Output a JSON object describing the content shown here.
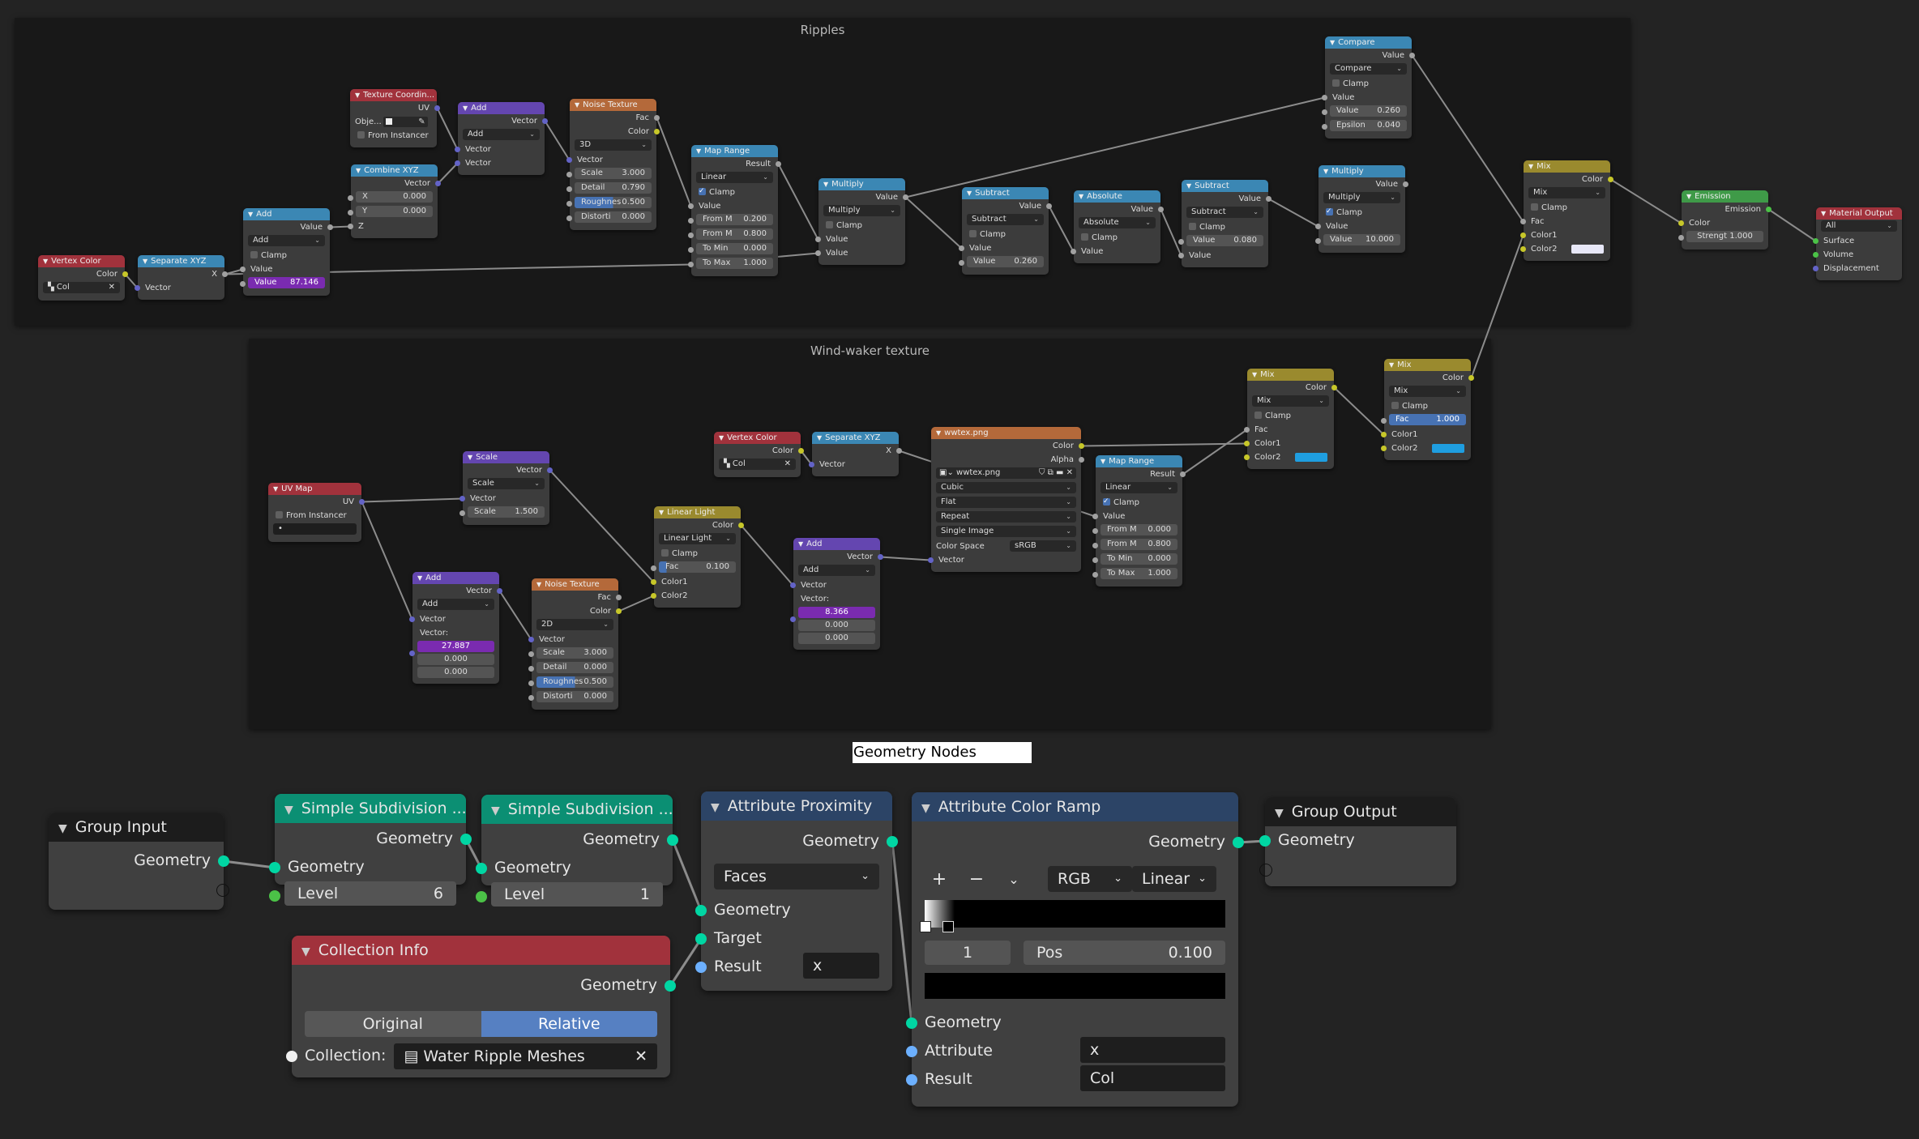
{
  "frames": {
    "ripples": {
      "title": "Ripples"
    },
    "windwaker": {
      "title": "Wind-waker texture"
    },
    "geometry_nodes_label": "Geometry Nodes"
  },
  "colors": {
    "header_input": "#a1323c",
    "header_converter": "#3b87b4",
    "header_vector": "#6446b0",
    "header_texture": "#b4693a",
    "header_color": "#9a8a2e",
    "header_shader": "#3f9a48",
    "header_output": "#a1323c",
    "header_geometry": "#0b8f73",
    "header_attribute": "#2c4466",
    "header_group": "#1c1c1c",
    "mix_color_white": "#e8e8f8",
    "mix_color_blue": "#1f9ee0"
  },
  "ripples": {
    "vertex_color": {
      "title": "Vertex Color",
      "out_color": "Color",
      "layer": "Col"
    },
    "separate_xyz": {
      "title": "Separate XYZ",
      "out_x": "X",
      "in_vector": "Vector"
    },
    "add_math": {
      "title": "Add",
      "out": "Value",
      "op": "Add",
      "clamp": "Clamp",
      "clamp_on": false,
      "in_value": "Value",
      "value_label": "Value",
      "value": "87.146"
    },
    "tex_coord": {
      "title": "Texture Coordin...",
      "out_uv": "UV",
      "object_label": "Obje...",
      "from_instancer": "From Instancer"
    },
    "combine_xyz": {
      "title": "Combine XYZ",
      "out": "Vector",
      "x_label": "X",
      "x": "0.000",
      "y_label": "Y",
      "y": "0.000",
      "z_label": "Z"
    },
    "vector_add": {
      "title": "Add",
      "out": "Vector",
      "op": "Add",
      "in1": "Vector",
      "in2": "Vector"
    },
    "noise": {
      "title": "Noise Texture",
      "out_fac": "Fac",
      "out_color": "Color",
      "dim": "3D",
      "in_vector": "Vector",
      "fields": [
        {
          "label": "Scale",
          "value": "3.000"
        },
        {
          "label": "Detail",
          "value": "0.790"
        },
        {
          "label": "Roughnes",
          "value": "0.500"
        },
        {
          "label": "Distorti",
          "value": "0.000"
        }
      ]
    },
    "map_range": {
      "title": "Map Range",
      "out": "Result",
      "mode": "Linear",
      "clamp": "Clamp",
      "clamp_on": true,
      "in_value": "Value",
      "fields": [
        {
          "label": "From M",
          "value": "0.200"
        },
        {
          "label": "From M",
          "value": "0.800"
        },
        {
          "label": "To Min",
          "value": "0.000"
        },
        {
          "label": "To Max",
          "value": "1.000"
        }
      ]
    },
    "multiply1": {
      "title": "Multiply",
      "out": "Value",
      "op": "Multiply",
      "clamp": "Clamp",
      "clamp_on": false,
      "in1": "Value",
      "in2": "Value"
    },
    "subtract1": {
      "title": "Subtract",
      "out": "Value",
      "op": "Subtract",
      "clamp": "Clamp",
      "clamp_on": false,
      "in1": "Value",
      "value_label": "Value",
      "value": "0.260"
    },
    "absolute": {
      "title": "Absolute",
      "out": "Value",
      "op": "Absolute",
      "clamp": "Clamp",
      "clamp_on": false,
      "in1": "Value"
    },
    "subtract2": {
      "title": "Subtract",
      "out": "Value",
      "op": "Subtract",
      "clamp": "Clamp",
      "clamp_on": false,
      "value_label": "Value",
      "value": "0.080",
      "in2": "Value"
    },
    "compare": {
      "title": "Compare",
      "out": "Value",
      "op": "Compare",
      "clamp": "Clamp",
      "clamp_on": false,
      "in1": "Value",
      "value_label": "Value",
      "value": "0.260",
      "eps_label": "Epsilon",
      "epsilon": "0.040"
    },
    "multiply2": {
      "title": "Multiply",
      "out": "Value",
      "op": "Multiply",
      "clamp": "Clamp",
      "clamp_on": true,
      "in1": "Value",
      "value_label": "Value",
      "value": "10.000"
    },
    "mix": {
      "title": "Mix",
      "out": "Color",
      "mode": "Mix",
      "clamp": "Clamp",
      "clamp_on": false,
      "fac": "Fac",
      "color1": "Color1",
      "color2": "Color2"
    },
    "emission": {
      "title": "Emission",
      "out": "Emission",
      "in_color": "Color",
      "strength_label": "Strengt",
      "strength": "1.000"
    },
    "material_output": {
      "title": "Material Output",
      "target": "All",
      "surface": "Surface",
      "volume": "Volume",
      "displacement": "Displacement"
    }
  },
  "windwaker": {
    "uv_map": {
      "title": "UV Map",
      "out": "UV",
      "from_instancer": "From Instancer",
      "map": "•"
    },
    "scale": {
      "title": "Scale",
      "out": "Vector",
      "op": "Scale",
      "in_vector": "Vector",
      "scale_label": "Scale",
      "scale": "1.500"
    },
    "add1": {
      "title": "Add",
      "out": "Vector",
      "op": "Add",
      "in_vector": "Vector",
      "vec_label": "Vector:",
      "values": [
        "27.887",
        "0.000",
        "0.000"
      ]
    },
    "noise": {
      "title": "Noise Texture",
      "out_fac": "Fac",
      "out_color": "Color",
      "dim": "2D",
      "in_vector": "Vector",
      "fields": [
        {
          "label": "Scale",
          "value": "3.000"
        },
        {
          "label": "Detail",
          "value": "0.000"
        },
        {
          "label": "Roughnes",
          "value": "0.500"
        },
        {
          "label": "Distorti",
          "value": "0.000"
        }
      ]
    },
    "linear_light": {
      "title": "Linear Light",
      "out": "Color",
      "mode": "Linear Light",
      "clamp": "Clamp",
      "clamp_on": false,
      "fac_label": "Fac",
      "fac": "0.100",
      "color1": "Color1",
      "color2": "Color2"
    },
    "vertex_color": {
      "title": "Vertex Color",
      "out": "Color",
      "layer": "Col"
    },
    "separate_xyz": {
      "title": "Separate XYZ",
      "out": "X",
      "in_vector": "Vector"
    },
    "add2": {
      "title": "Add",
      "out": "Vector",
      "op": "Add",
      "in_vector": "Vector",
      "vec_label": "Vector:",
      "values": [
        "8.366",
        "0.000",
        "0.000"
      ]
    },
    "image": {
      "title": "wwtex.png",
      "out_color": "Color",
      "out_alpha": "Alpha",
      "image": "wwtex.png",
      "interp": "Cubic",
      "projection": "Flat",
      "extension": "Repeat",
      "source": "Single Image",
      "cs_label": "Color Space",
      "color_space": "sRGB",
      "in_vector": "Vector"
    },
    "map_range": {
      "title": "Map Range",
      "out": "Result",
      "mode": "Linear",
      "clamp": "Clamp",
      "clamp_on": true,
      "in_value": "Value",
      "fields": [
        {
          "label": "From M",
          "value": "0.000"
        },
        {
          "label": "From M",
          "value": "0.800"
        },
        {
          "label": "To Min",
          "value": "0.000"
        },
        {
          "label": "To Max",
          "value": "1.000"
        }
      ]
    },
    "mix1": {
      "title": "Mix",
      "out": "Color",
      "mode": "Mix",
      "clamp": "Clamp",
      "clamp_on": false,
      "fac": "Fac",
      "color1": "Color1",
      "color2": "Color2"
    },
    "mix2": {
      "title": "Mix",
      "out": "Color",
      "mode": "Mix",
      "clamp": "Clamp",
      "clamp_on": false,
      "fac_label": "Fac",
      "fac": "1.000",
      "color1": "Color1",
      "color2": "Color2"
    }
  },
  "geometry": {
    "group_input": {
      "title": "Group Input",
      "out": "Geometry"
    },
    "subdiv1": {
      "title": "Simple Subdivision ...",
      "out": "Geometry",
      "in": "Geometry",
      "level_label": "Level",
      "level": "6"
    },
    "subdiv2": {
      "title": "Simple Subdivision ...",
      "out": "Geometry",
      "in": "Geometry",
      "level_label": "Level",
      "level": "1"
    },
    "collection_info": {
      "title": "Collection Info",
      "out": "Geometry",
      "mode_options": [
        "Original",
        "Relative"
      ],
      "mode_selected": "Relative",
      "collection_label": "Collection:",
      "collection": "Water Ripple Meshes"
    },
    "attr_proximity": {
      "title": "Attribute Proximity",
      "out": "Geometry",
      "domain": "Faces",
      "in_geometry": "Geometry",
      "in_target": "Target",
      "result_label": "Result",
      "result": "x"
    },
    "attr_color_ramp": {
      "title": "Attribute Color Ramp",
      "out": "Geometry",
      "add": "+",
      "remove": "−",
      "menu": "⌄",
      "color_mode": "RGB",
      "interp": "Linear",
      "stop_index": "1",
      "pos_label": "Pos",
      "pos": "0.100",
      "in_geometry": "Geometry",
      "attr_label": "Attribute",
      "attribute": "x",
      "result_label": "Result",
      "result": "Col"
    },
    "group_output": {
      "title": "Group Output",
      "in": "Geometry"
    }
  }
}
